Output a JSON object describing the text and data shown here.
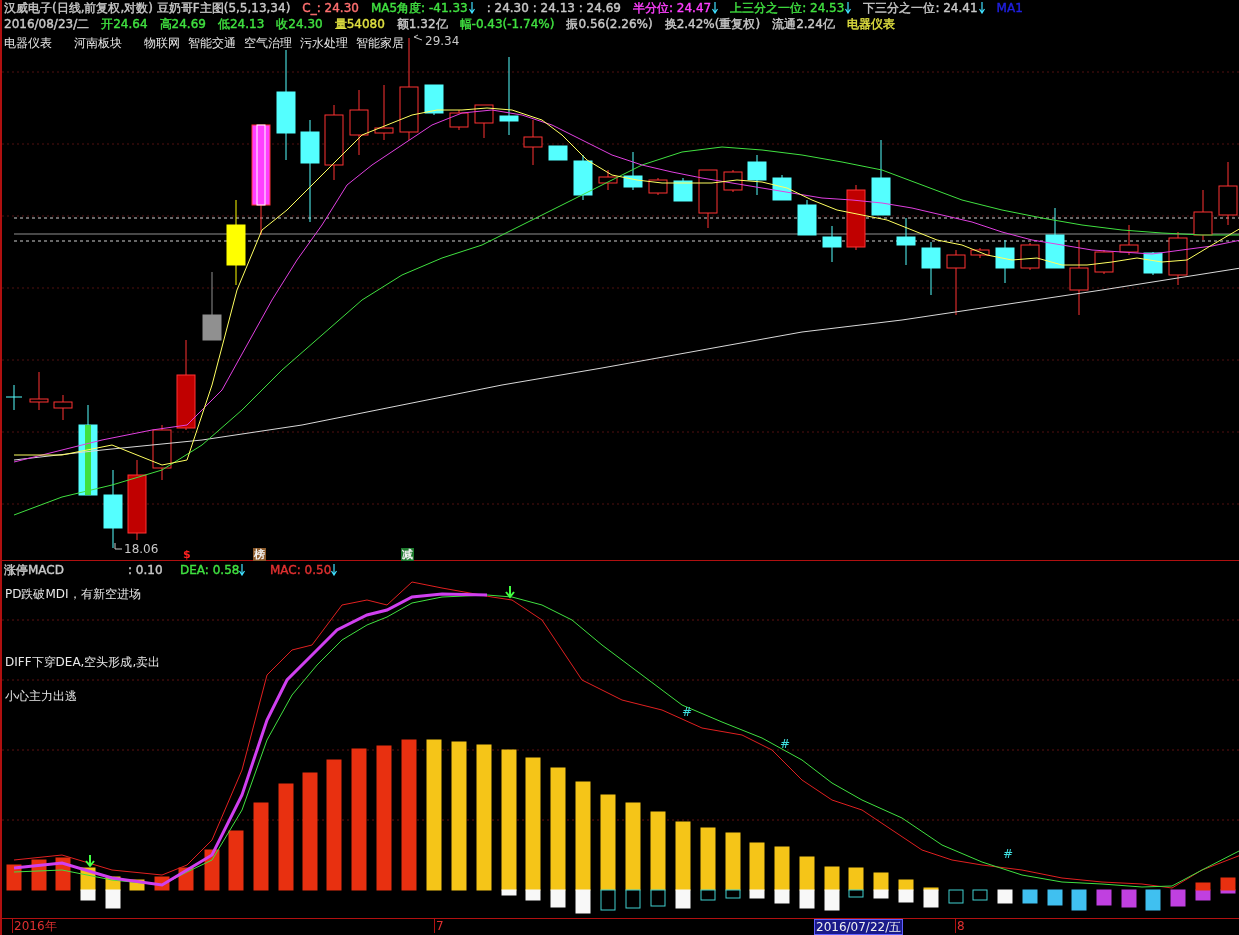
{
  "header": {
    "lines": [
      [
        {
          "text": "汉威电子(日线,前复权,对数) 豆奶哥F主图(5,5,13,34)",
          "color": "#c8c8c8",
          "arrow": false
        },
        {
          "text": "C_: 24.30",
          "color": "#ff7070",
          "arrow": false
        },
        {
          "text": "MA5角度: -41.33",
          "color": "#40e040",
          "arrow": true
        },
        {
          "text": ": 24.30 : 24.13 : 24.69",
          "color": "#c8c8c8",
          "arrow": false
        },
        {
          "text": "半分位: 24.47",
          "color": "#ff40ff",
          "arrow": true
        },
        {
          "text": "上三分之一位: 24.53",
          "color": "#40e040",
          "arrow": true
        },
        {
          "text": "下三分之一位: 24.41",
          "color": "#c8c8c8",
          "arrow": true
        },
        {
          "text": "MA1",
          "color": "#2020e0",
          "arrow": false
        }
      ],
      [
        {
          "text": "2016/08/23/二",
          "color": "#c8c8c8",
          "arrow": false
        },
        {
          "text": "开24.64",
          "color": "#40e040",
          "arrow": false
        },
        {
          "text": "高24.69",
          "color": "#40e040",
          "arrow": false
        },
        {
          "text": "低24.13",
          "color": "#40e040",
          "arrow": false
        },
        {
          "text": "收24.30",
          "color": "#40e040",
          "arrow": false
        },
        {
          "text": "量54080",
          "color": "#e0e040",
          "arrow": false
        },
        {
          "text": "额1.32亿",
          "color": "#c8c8c8",
          "arrow": false
        },
        {
          "text": "幅-0.43(-1.74%)",
          "color": "#40e040",
          "arrow": false
        },
        {
          "text": "振0.56(2.26%)",
          "color": "#c8c8c8",
          "arrow": false
        },
        {
          "text": "换2.42%(重复权)",
          "color": "#c8c8c8",
          "arrow": false
        },
        {
          "text": "流通2.24亿",
          "color": "#c8c8c8",
          "arrow": false
        },
        {
          "text": "电器仪表",
          "color": "#e0e040",
          "arrow": false
        }
      ]
    ]
  },
  "price_chart": {
    "sector_tags": [
      "电器仪表",
      "河南板块",
      "物联网",
      "智能交通",
      "空气治理",
      "污水处理",
      "智能家居"
    ],
    "high_label": "29.34",
    "low_label": "18.06",
    "signal_marks": [
      {
        "text": "$",
        "kind": "plain"
      },
      {
        "text": "榜",
        "kind": "boxed",
        "color": "#8b5a2b"
      },
      {
        "text": "减",
        "kind": "boxed",
        "color": "#1e7a2e"
      }
    ]
  },
  "macd": {
    "readouts": [
      {
        "text": "涨停MACD",
        "color": "#c8c8c8",
        "arrow": false
      },
      {
        "text": ": 0.10",
        "color": "#c8c8c8",
        "arrow": false
      },
      {
        "text": "DEA: 0.58",
        "color": "#40e040",
        "arrow": true
      },
      {
        "text": "MAC: 0.50",
        "color": "#e03030",
        "arrow": true
      }
    ],
    "notes": [
      "PD跌破MDI，有新空进场",
      "DIFF下穿DEA,空头形成,卖出",
      "小心主力出逃"
    ],
    "cross_marks": [
      "#",
      "#",
      "#"
    ]
  },
  "time_axis": [
    {
      "text": "2016年",
      "selected": false
    },
    {
      "text": "7",
      "selected": false
    },
    {
      "text": "2016/07/22/五",
      "selected": true
    },
    {
      "text": "8",
      "selected": false
    }
  ]
}
